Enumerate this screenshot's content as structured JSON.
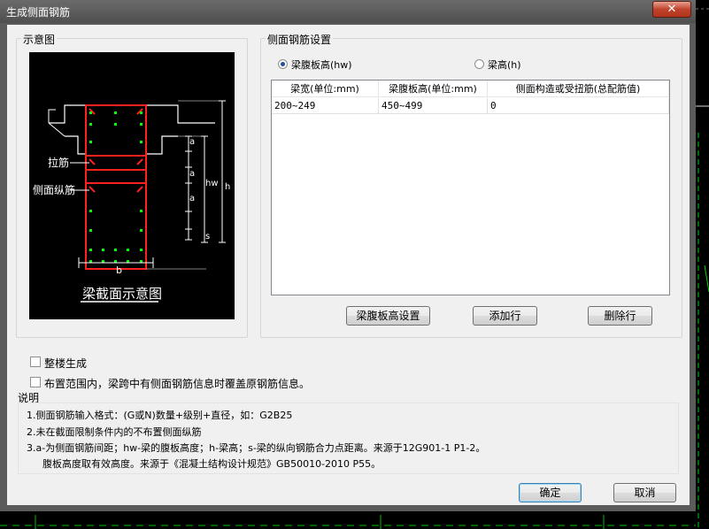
{
  "window": {
    "title": "生成侧面钢筋",
    "close_glyph": "✕"
  },
  "diagram_group": {
    "label": "示意图",
    "diagram": {
      "label_tie": "拉筋",
      "label_side_bar": "侧面纵筋",
      "label_a1": "a",
      "label_a2": "a",
      "label_a3": "a",
      "label_hw": "hw",
      "label_h": "h",
      "label_s": "s",
      "label_b": "b",
      "caption": "梁截面示意图"
    }
  },
  "settings_group": {
    "label": "侧面钢筋设置",
    "radio_web_height": {
      "label": "梁腹板高(hw)",
      "checked": true
    },
    "radio_beam_height": {
      "label": "梁高(h)",
      "checked": false
    },
    "table": {
      "columns": [
        "梁宽(单位:mm)",
        "梁腹板高(单位:mm)",
        "侧面构造或受扭筋(总配筋值)"
      ],
      "rows": [
        [
          "200~249",
          "450~499",
          "0"
        ]
      ]
    },
    "buttons": {
      "web_height_settings": "梁腹板高设置",
      "add_row": "添加行",
      "delete_row": "删除行"
    }
  },
  "options": {
    "whole_building": {
      "label": "整楼生成",
      "checked": false
    },
    "overwrite": {
      "label": "布置范围内，梁跨中有侧面钢筋信息时覆盖原钢筋信息。",
      "checked": false
    }
  },
  "notes": {
    "title": "说明",
    "line1": "1.侧面钢筋输入格式：(G或N)数量+级别+直径，如：G2B25",
    "line2": "2.未在截面限制条件内的不布置侧面纵筋",
    "line3": "3.a-为侧面钢筋间距；hw-梁的腹板高度；h-梁高；s-梁的纵向钢筋合力点距离。来源于12G901-1 P1-2。",
    "line4": "腹板高度取有效高度。来源于《混凝土结构设计规范》GB50010-2010 P55。"
  },
  "footer": {
    "ok": "确定",
    "cancel": "取消"
  },
  "colors": {
    "accent": "#3c7fb1",
    "rebar": "#ff2020",
    "dots": "#00ff00",
    "titlebar": "#5b5b5b"
  }
}
